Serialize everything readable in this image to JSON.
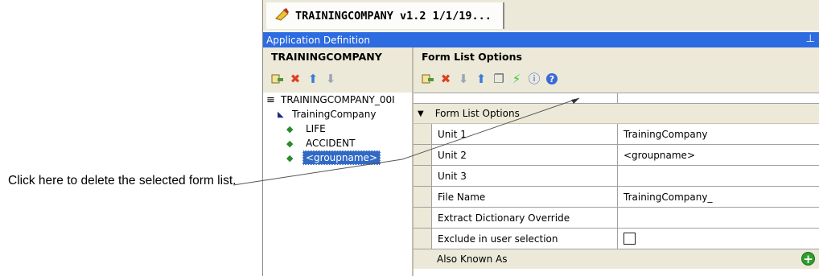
{
  "callout": {
    "text": "Click here to delete the selected form list."
  },
  "document_tab": {
    "title": "TRAININGCOMPANY v1.2 1/1/19..."
  },
  "window": {
    "title": "Application Definition",
    "pin_glyph": "ꟷ"
  },
  "left_pane": {
    "header": "TRAININGCOMPANY",
    "toolbar": [
      {
        "name": "add-icon",
        "glyph": "➕"
      },
      {
        "name": "delete-icon",
        "glyph": "✖"
      },
      {
        "name": "move-up-icon",
        "glyph": "⬆"
      },
      {
        "name": "move-down-icon",
        "glyph": "⬇"
      }
    ],
    "tree": {
      "root": "TRAININGCOMPANY_00I",
      "company": "TrainingCompany",
      "items": [
        "LIFE",
        "ACCIDENT",
        "<groupname>"
      ]
    }
  },
  "right_pane": {
    "header": "Form List Options",
    "toolbar": [
      {
        "name": "add-icon",
        "glyph": "➕"
      },
      {
        "name": "delete-icon",
        "glyph": "✖"
      },
      {
        "name": "move-down-icon",
        "glyph": "⬇"
      },
      {
        "name": "move-up-icon",
        "glyph": "⬆"
      },
      {
        "name": "copy-icon",
        "glyph": "❐"
      },
      {
        "name": "lightning-icon",
        "glyph": "⚡"
      },
      {
        "name": "info-icon",
        "glyph": "ⓘ"
      },
      {
        "name": "help-icon",
        "glyph": "?"
      }
    ],
    "category": "Form List Options",
    "properties": [
      {
        "name": "Unit 1",
        "value": "TrainingCompany"
      },
      {
        "name": "Unit 2",
        "value": "<groupname>"
      },
      {
        "name": "Unit 3",
        "value": ""
      },
      {
        "name": "File Name",
        "value": "TrainingCompany_"
      },
      {
        "name": "Extract Dictionary Override",
        "value": ""
      },
      {
        "name": "Exclude in user selection",
        "value": "",
        "checkbox": true
      }
    ],
    "also_known_as": "Also Known As"
  },
  "colors": {
    "title_bar": "#2d6be0",
    "selection": "#316ac5",
    "panel": "#ece9d8"
  }
}
